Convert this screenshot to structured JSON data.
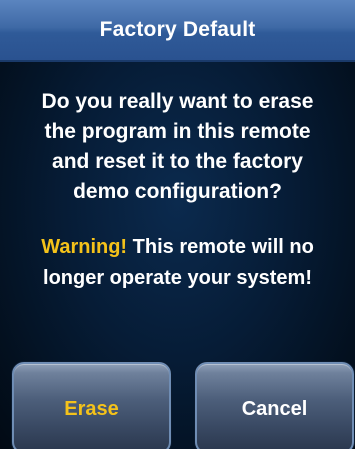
{
  "dialog": {
    "title": "Factory Default",
    "message_lines": [
      "Do you really want to erase",
      "the program in this remote",
      "and reset it to the factory",
      "demo configuration?"
    ],
    "warning_label": "Warning!",
    "warning_line1_rest": " This remote will no",
    "warning_line2": "longer operate your system!"
  },
  "buttons": {
    "erase_label": "Erase",
    "cancel_label": "Cancel"
  },
  "colors": {
    "title_bar": "#3f6aa6",
    "background": "#061c36",
    "warning_accent": "#f4c21a",
    "text": "#ffffff"
  }
}
